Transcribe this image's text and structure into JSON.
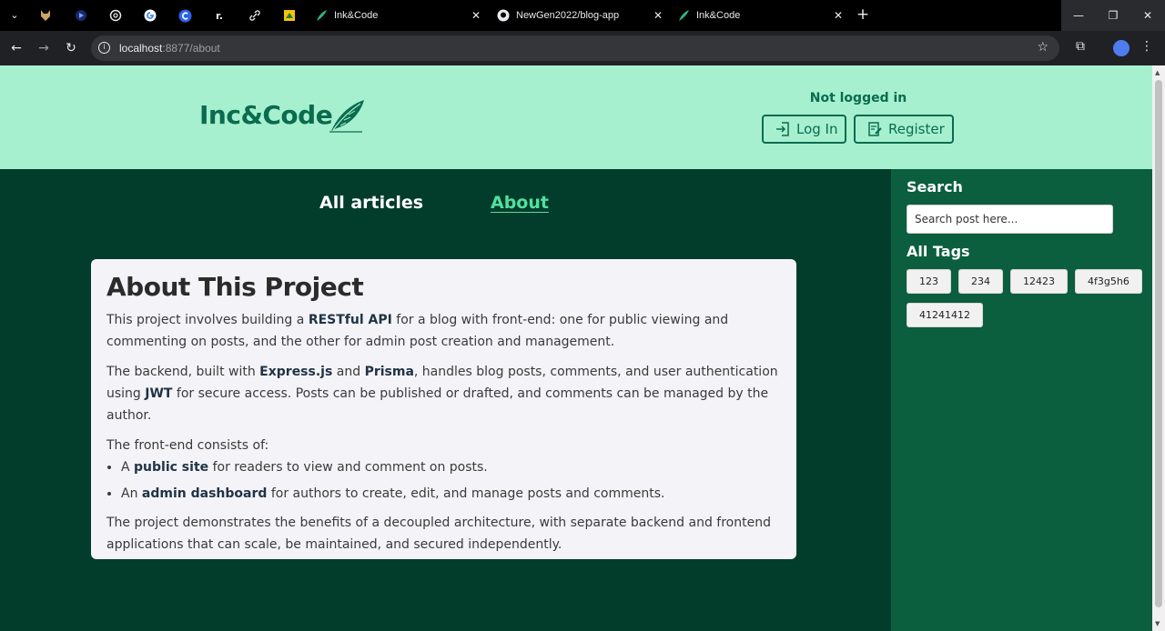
{
  "browser": {
    "tabs": [
      {
        "title": "Ink&Code",
        "active": false
      },
      {
        "title": "NewGen2022/blog-app",
        "active": false
      },
      {
        "title": "Ink&Code",
        "active": true
      }
    ],
    "pinned_icons": [
      "tab-search-icon",
      "fox-icon",
      "play-icon",
      "openai-icon",
      "google-icon",
      "c-icon",
      "r-icon",
      "link-icon",
      "drive-icon"
    ],
    "pinned_letters": {
      "r": "r."
    },
    "url_host": "localhost",
    "url_rest": ":8877/about"
  },
  "header": {
    "logo": "Inc&Code",
    "auth_status": "Not logged in",
    "login_label": "Log In",
    "register_label": "Register"
  },
  "nav": {
    "all_articles": "All articles",
    "about": "About"
  },
  "about": {
    "title": "About This Project",
    "p1_a": "This project involves building a ",
    "p1_b": "RESTful API",
    "p1_c": " for a blog with front-end: one for public viewing and commenting on posts, and the other for admin post creation and management.",
    "p2_a": "The backend, built with ",
    "p2_b": "Express.js",
    "p2_c": " and ",
    "p2_d": "Prisma",
    "p2_e": ", handles blog posts, comments, and user authentication using ",
    "p2_f": "JWT",
    "p2_g": " for secure access. Posts can be published or drafted, and comments can be managed by the author.",
    "p3": "The front-end consists of:",
    "li1_a": "A ",
    "li1_b": "public site",
    "li1_c": " for readers to view and comment on posts.",
    "li2_a": "An ",
    "li2_b": "admin dashboard",
    "li2_c": " for authors to create, edit, and manage posts and comments.",
    "p4": "The project demonstrates the benefits of a decoupled architecture, with separate backend and frontend applications that can scale, be maintained, and secured independently."
  },
  "sidebar": {
    "search_title": "Search",
    "search_placeholder": "Search post here...",
    "tags_title": "All Tags",
    "tags": [
      "123",
      "234",
      "12423",
      "4f3g5h6",
      "41241412"
    ]
  },
  "colors": {
    "header_bg": "#a6f0d0",
    "main_bg": "#023d2b",
    "sidebar_bg": "#0b5e3e",
    "brand": "#0b6b4e",
    "active_link": "#52e0a0"
  }
}
